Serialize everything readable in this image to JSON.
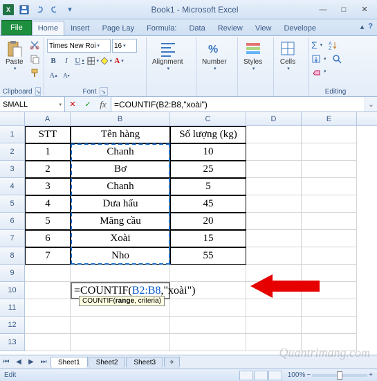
{
  "title": "Book1 - Microsoft Excel",
  "tabs": {
    "file": "File",
    "home": "Home",
    "insert": "Insert",
    "pagelayout": "Page Lay",
    "formulas": "Formula:",
    "data": "Data",
    "review": "Review",
    "view": "View",
    "developer": "Develope"
  },
  "ribbon": {
    "clipboard": "Clipboard",
    "paste": "Paste",
    "font": "Font",
    "font_name": "Times New Roi",
    "font_size": "16",
    "alignment": "Alignment",
    "number": "Number",
    "styles": "Styles",
    "cells": "Cells",
    "editing": "Editing"
  },
  "namebox": "SMALL",
  "formula_bar": "=COUNTIF(B2:B8,\"xoài\")",
  "columns": [
    "A",
    "B",
    "C",
    "D",
    "E"
  ],
  "headers": {
    "a": "STT",
    "b": "Tên hàng",
    "c": "Số lượng (kg)"
  },
  "rows": [
    {
      "a": "1",
      "b": "Chanh",
      "c": "10"
    },
    {
      "a": "2",
      "b": "Bơ",
      "c": "25"
    },
    {
      "a": "3",
      "b": "Chanh",
      "c": "5"
    },
    {
      "a": "4",
      "b": "Dưa hấu",
      "c": "45"
    },
    {
      "a": "5",
      "b": "Măng cầu",
      "c": "20"
    },
    {
      "a": "6",
      "b": "Xoài",
      "c": "15"
    },
    {
      "a": "7",
      "b": "Nho",
      "c": "55"
    }
  ],
  "editing_cell": {
    "prefix": "=COUNTIF(",
    "range": "B2:B8",
    "suffix": ",\"xoài\")"
  },
  "tooltip": {
    "fn": "COUNTIF(",
    "bold": "range",
    "rest": ", criteria)"
  },
  "sheets": [
    "Sheet1",
    "Sheet2",
    "Sheet3"
  ],
  "status": "Edit",
  "zoom": "100%",
  "watermark": "Quantrimang.com"
}
